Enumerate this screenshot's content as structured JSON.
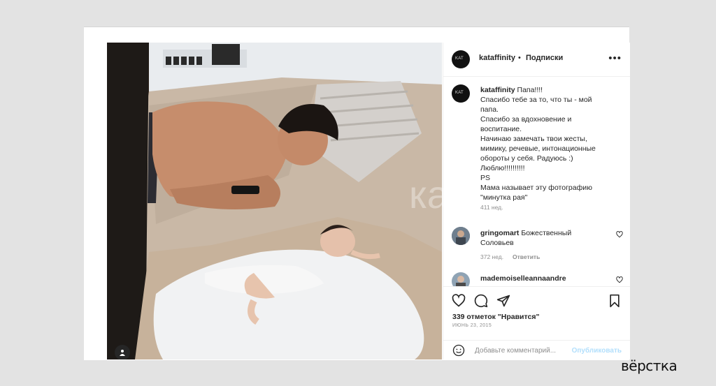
{
  "post": {
    "username": "kataffinity",
    "separator": "•",
    "follow_label": "Подписки",
    "more_label": "•••"
  },
  "caption": {
    "username": "kataffinity",
    "lines": [
      "Папа!!!!",
      "Спасибо тебе за то, что ты - мой",
      "папа.",
      "Спасибо за вдохновение и",
      "воспитание.",
      "Начинаю замечать твои жесты,",
      "мимику, речевые, интонационные",
      "обороты у себя. Радуюсь :)",
      "Люблю!!!!!!!!!!",
      "PS",
      "Мама называет эту фотографию",
      "\"минутка рая\""
    ],
    "age": "411 нед."
  },
  "comments": [
    {
      "username": "gringomart",
      "text": "Божественный",
      "text2": "Соловьев",
      "age": "372 нед.",
      "reply": "Ответить"
    },
    {
      "username": "mademoiselleannaandre",
      "text": ""
    }
  ],
  "likes": "339 отметок \"Нравится\"",
  "date": "ИЮНЬ 23, 2015",
  "add_comment_placeholder": "Добавьте комментарий...",
  "publish_label": "Опубликовать",
  "watermark": "ка",
  "brand": "вёрстка",
  "colors": {
    "publish": "#b2dffc",
    "meta": "#8e8e8e",
    "text": "#262626"
  },
  "icons": [
    "heart-icon",
    "comment-icon",
    "share-icon",
    "bookmark-icon",
    "emoji-icon",
    "user-tag-icon"
  ]
}
